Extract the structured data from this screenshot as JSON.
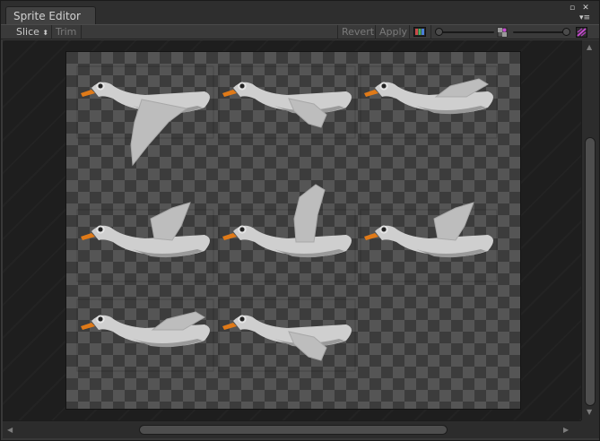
{
  "window": {
    "title": "Sprite Editor"
  },
  "window_controls": {
    "maximize_glyph": "▫",
    "close_glyph": "✕",
    "menu_glyph": "▾≡"
  },
  "toolbar": {
    "slice_label": "Slice",
    "slice_arrow": "⬍",
    "trim_label": "Trim",
    "revert_label": "Revert",
    "apply_label": "Apply"
  },
  "zoom_slider": {
    "value": 0.0
  },
  "mip_slider": {
    "value": 1.0
  },
  "colors": {
    "accent_red": "#c94a4a",
    "accent_green": "#4fae5f",
    "accent_blue": "#4a7fd8",
    "alpha_pink": "#c84bd1",
    "bird_body": "#cfcfcf",
    "bird_wing": "#bdbdbd",
    "beak": "#e07a18"
  },
  "sprite_sheet": {
    "rows": 3,
    "cols": 3,
    "frames": [
      {
        "pose": "wing-down"
      },
      {
        "pose": "wing-low"
      },
      {
        "pose": "wing-level"
      },
      {
        "pose": "wing-mid"
      },
      {
        "pose": "wing-up"
      },
      {
        "pose": "wing-mid"
      },
      {
        "pose": "wing-level"
      },
      {
        "pose": "wing-low"
      }
    ]
  }
}
